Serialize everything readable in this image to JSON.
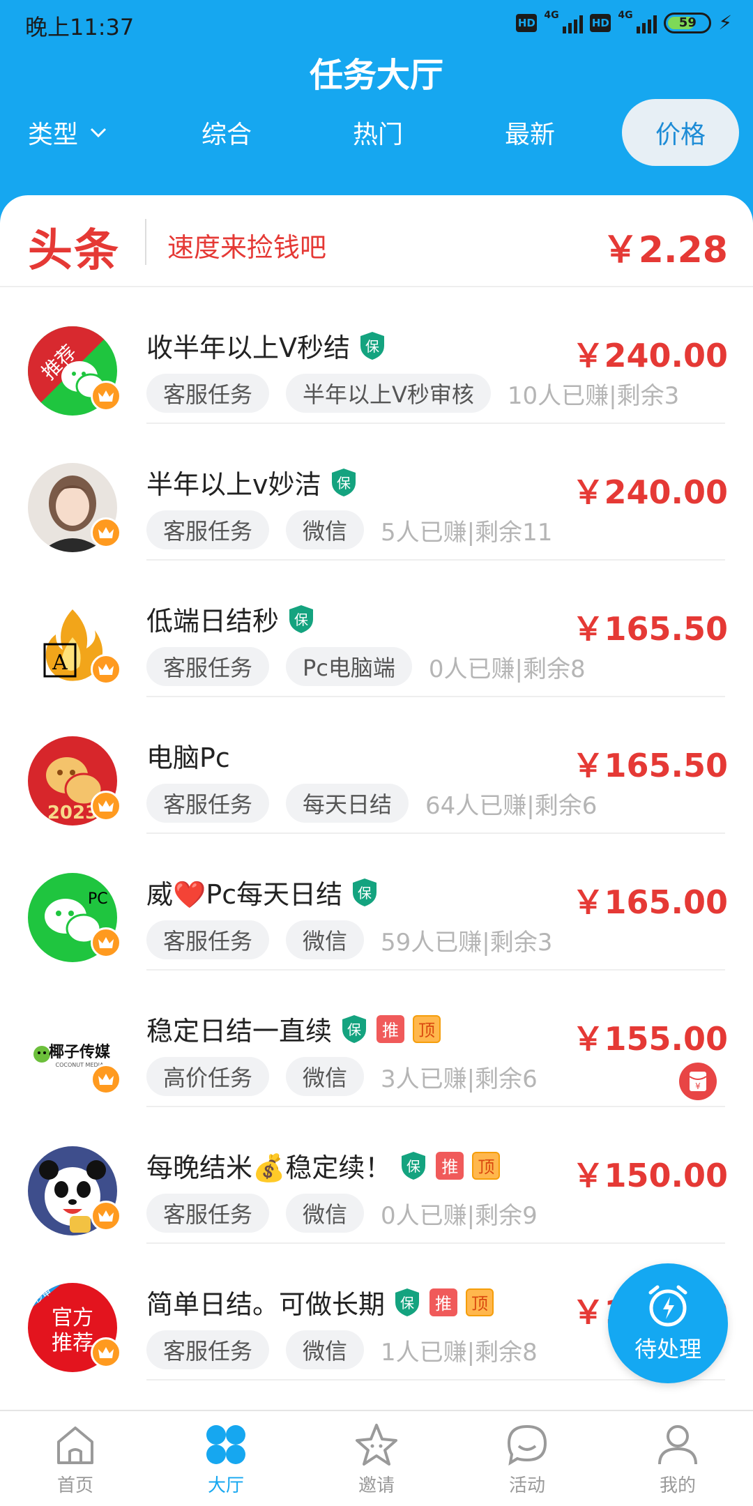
{
  "status_bar": {
    "time": "晚上11:37",
    "hd1": "HD",
    "net1": "4G",
    "hd2": "HD",
    "net2": "4G",
    "battery": "59"
  },
  "header": {
    "title": "任务大厅"
  },
  "filter_tabs": {
    "type_label": "类型",
    "tabs": [
      "综合",
      "热门",
      "最新",
      "价格"
    ],
    "selected": "价格"
  },
  "headline": {
    "logo": "头条",
    "text": "速度来捡钱吧",
    "price": "￥2.28"
  },
  "tasks": [
    {
      "title": "收半年以上V秒结",
      "badges": [
        "保"
      ],
      "tags": [
        "客服任务",
        "半年以上V秒审核"
      ],
      "stats": "10人已赚|剩余3",
      "price": "￥240.00",
      "avatar": "wechat-recommend"
    },
    {
      "title": "半年以上v妙洁",
      "badges": [
        "保"
      ],
      "tags": [
        "客服任务",
        "微信"
      ],
      "stats": "5人已赚|剩余11",
      "price": "￥240.00",
      "avatar": "girl-photo"
    },
    {
      "title": "低端日结秒",
      "badges": [
        "保"
      ],
      "tags": [
        "客服任务",
        "Pc电脑端"
      ],
      "stats": "0人已赚|剩余8",
      "price": "￥165.50",
      "avatar": "fire-logo"
    },
    {
      "title": "电脑Pc",
      "badges": [],
      "tags": [
        "客服任务",
        "每天日结"
      ],
      "stats": "64人已赚|剩余6",
      "price": "￥165.50",
      "avatar": "wechat-2023"
    },
    {
      "title": "威❤️Pc每天日结",
      "badges": [
        "保"
      ],
      "tags": [
        "客服任务",
        "微信"
      ],
      "stats": "59人已赚|剩余3",
      "price": "￥165.00",
      "avatar": "wechat-pc"
    },
    {
      "title": "稳定日结一直续",
      "badges": [
        "保",
        "推",
        "顶"
      ],
      "tags": [
        "高价任务",
        "微信"
      ],
      "stats": "3人已赚|剩余6",
      "price": "￥155.00",
      "avatar": "coconut-media"
    },
    {
      "title": "每晚结米💰稳定续！",
      "badges": [
        "保",
        "推",
        "顶"
      ],
      "tags": [
        "客服任务",
        "微信"
      ],
      "stats": "0人已赚|剩余9",
      "price": "￥150.00",
      "avatar": "panda"
    },
    {
      "title": "简单日结。可做长期",
      "badges": [
        "保",
        "推",
        "顶"
      ],
      "tags": [
        "客服任务",
        "微信"
      ],
      "stats": "1人已赚|剩余8",
      "price": "￥160.00",
      "avatar": "official-recommend"
    }
  ],
  "avatar_text": {
    "recommend": "推荐",
    "pc": "PC",
    "year": "2023",
    "media_brand": "椰子传媒",
    "media_sub": "COCONUT MEDIA",
    "official": "官方",
    "official2": "推荐",
    "official_tag": "秒审"
  },
  "fab": {
    "label": "待处理"
  },
  "bottom_nav": [
    {
      "label": "首页",
      "icon": "home-icon"
    },
    {
      "label": "大厅",
      "icon": "hall-icon",
      "active": true
    },
    {
      "label": "邀请",
      "icon": "star-icon"
    },
    {
      "label": "活动",
      "icon": "chat-icon"
    },
    {
      "label": "我的",
      "icon": "user-icon"
    }
  ],
  "colors": {
    "brand": "#16A7F0",
    "price": "#E53935",
    "badge_green": "#14A37F"
  }
}
